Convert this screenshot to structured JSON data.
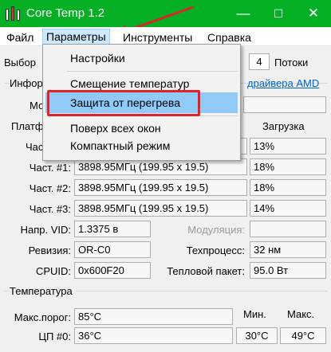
{
  "window": {
    "title": "Core Temp 1.2",
    "controls": {
      "minimize": "—",
      "maximize": "☐",
      "close": "✕"
    }
  },
  "menu": {
    "items": [
      "Файл",
      "Параметры",
      "Инструменты",
      "Справка"
    ],
    "open_index": 1
  },
  "dropdown": {
    "items": [
      "Настройки",
      "Смещение температур",
      "Защита от перегрева",
      "Поверх всех окон",
      "Компактный режим"
    ],
    "highlighted_index": 2
  },
  "cpu": {
    "select_label": "Выбор",
    "threads_value": "4",
    "threads_label": "Потоки",
    "info_label": "Инфор",
    "driver_link": "драйвера AMD",
    "model_label": "Мо",
    "platform_label": "Платф",
    "load_header": "Загрузка",
    "freq_label_cut": "Част",
    "rows": [
      {
        "label": "Част. #1:",
        "freq": "3898.95МГц (199.95 x 19.5)",
        "load": "18%"
      },
      {
        "label": "Част. #2:",
        "freq": "3898.95МГц (199.95 x 19.5)",
        "load": "18%"
      },
      {
        "label": "Част. #3:",
        "freq": "3898.95МГц (199.95 x 19.5)",
        "load": "14%"
      }
    ],
    "first_load": "13%",
    "vid_label": "Напр. VID:",
    "vid_value": "1.3375 в",
    "modulation_label": "Модуляция:",
    "revision_label": "Ревизия:",
    "revision_value": "OR-C0",
    "process_label": "Техпроцесс:",
    "process_value": "32 нм",
    "cpuid_label": "CPUID:",
    "cpuid_value": "0x600F20",
    "tdp_label": "Тепловой пакет:",
    "tdp_value": "95.0 Вт"
  },
  "temperature": {
    "group_label": "Температура",
    "max_threshold_label": "Макс.порог:",
    "max_threshold_value": "85°C",
    "min_header": "Мин.",
    "max_header": "Макс.",
    "cpu0_label": "ЦП #0:",
    "cpu0_value": "36°C",
    "cpu0_min": "30°C",
    "cpu0_max": "49°C"
  },
  "colors": {
    "titlebar": "#06b024",
    "highlight_border": "#e0232b",
    "menu_hover": "#91c9f7",
    "link": "#0066cc"
  }
}
